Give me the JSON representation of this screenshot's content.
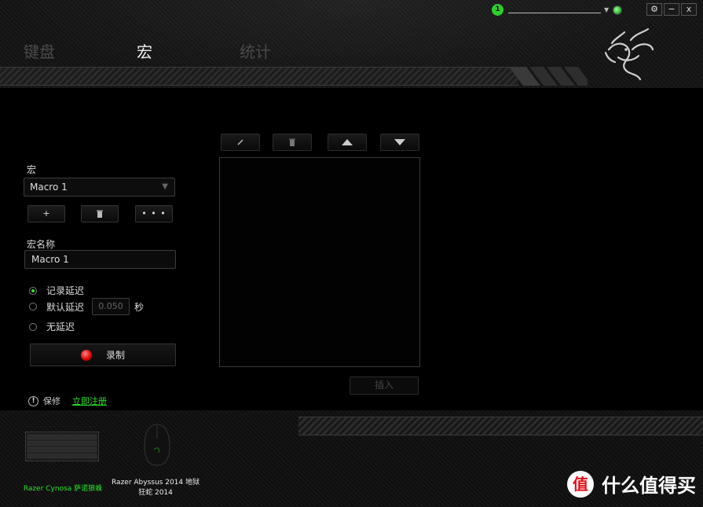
{
  "header": {
    "tabs": [
      {
        "label": "键盘",
        "active": false
      },
      {
        "label": "宏",
        "active": true
      },
      {
        "label": "统计",
        "active": false
      }
    ],
    "profile_number": "1",
    "window_controls": [
      "⚙",
      "−",
      "x"
    ]
  },
  "macro_panel": {
    "macro_label": "宏",
    "selected_macro": "Macro 1",
    "add_button": "+",
    "delete_icon": "trash-icon",
    "more_button": "• • •",
    "name_label": "宏名称",
    "name_value": "Macro 1",
    "delay_options": [
      {
        "label": "记录延迟",
        "selected": true
      },
      {
        "label": "默认延迟",
        "selected": false
      },
      {
        "label": "无延迟",
        "selected": false
      }
    ],
    "default_delay_value": "0.050",
    "delay_unit": "秒",
    "record_label": "录制"
  },
  "editor": {
    "toolbar_icons": [
      "edit-icon",
      "trash-icon",
      "arrow-up-icon",
      "arrow-down-icon"
    ],
    "insert_label": "插入"
  },
  "warranty": {
    "label": "保修",
    "register_link": "立即注册"
  },
  "devices": [
    {
      "name": "Razer Cynosa 萨诺狼蛛",
      "selected": true
    },
    {
      "name": "Razer Abyssus 2014 地狱狂蛇 2014",
      "selected": false
    }
  ],
  "watermark": {
    "logo": "值",
    "text": "什么值得买"
  },
  "colors": {
    "accent_green": "#2ae52a",
    "record_red": "#e00000",
    "background": "#000000"
  }
}
